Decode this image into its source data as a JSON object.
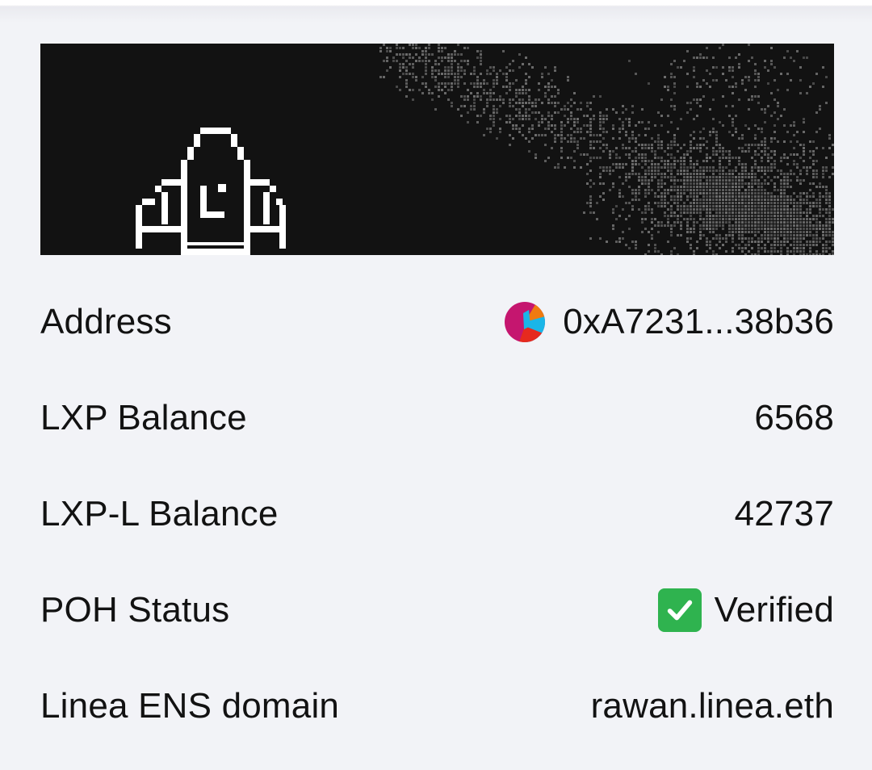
{
  "rows": [
    {
      "label": "Address",
      "value": "0xA7231...38b36",
      "icon": "avatar-identicon"
    },
    {
      "label": "LXP Balance",
      "value": "6568"
    },
    {
      "label": "LXP-L Balance",
      "value": "42737"
    },
    {
      "label": "POH Status",
      "value": "Verified",
      "icon": "check-mark-icon"
    },
    {
      "label": "Linea ENS domain",
      "value": "rawan.linea.eth"
    }
  ],
  "colors": {
    "background": "#f2f3f7",
    "banner": "#121212",
    "text": "#121212",
    "verified_green": "#2fb34f"
  },
  "banner": {
    "icon": "pixel-rocket-icon"
  }
}
